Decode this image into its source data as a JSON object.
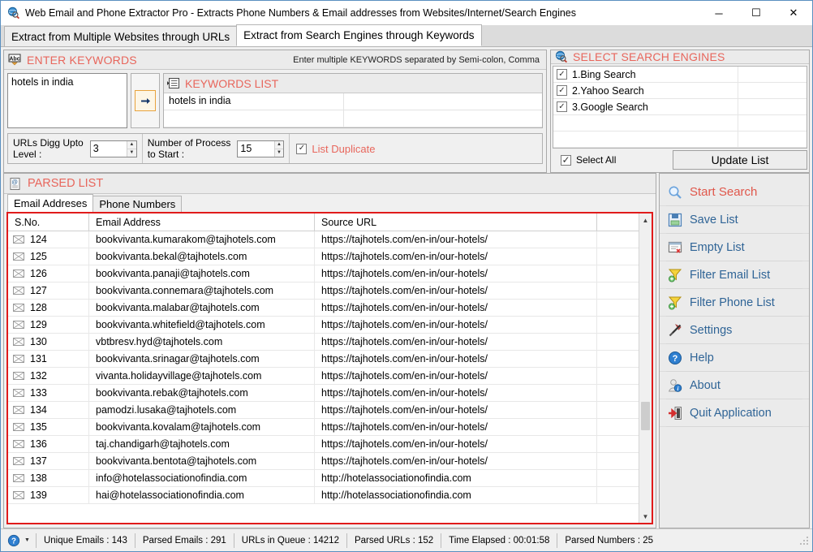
{
  "window": {
    "title": "Web Email and Phone Extractor Pro - Extracts Phone Numbers & Email addresses from Websites/Internet/Search Engines",
    "icon": "globe-search-icon",
    "minimize": "─",
    "maximize": "☐",
    "close": "✕"
  },
  "tabs": [
    {
      "label": "Extract from Multiple Websites through URLs",
      "active": false
    },
    {
      "label": "Extract from Search Engines through Keywords",
      "active": true
    }
  ],
  "keywords_panel": {
    "title": "ENTER KEYWORDS",
    "icon": "abc-spellcheck-icon",
    "hint": "Enter multiple KEYWORDS separated by Semi-colon, Comma",
    "textarea_value": "hotels in india",
    "textarea_placeholder": "",
    "add_button_icon": "arrow-right-icon",
    "list_title": "KEYWORDS LIST",
    "list_icon": "list-icon",
    "list_items": [
      "hotels in india"
    ]
  },
  "options": {
    "digg_level_label": "URLs Digg Upto\nLevel :",
    "digg_level_label_line1": "URLs Digg Upto",
    "digg_level_label_line2": "Level :",
    "digg_level_value": "3",
    "process_label_line1": "Number of Process",
    "process_label_line2": "to Start :",
    "process_value": "15",
    "list_duplicate_label": "List Duplicate",
    "list_duplicate_checked": true
  },
  "search_engines": {
    "title": "SELECT SEARCH ENGINES",
    "icon": "globe-search-icon",
    "items": [
      {
        "label": "1.Bing Search",
        "checked": true
      },
      {
        "label": "2.Yahoo Search",
        "checked": true
      },
      {
        "label": "3.Google Search",
        "checked": true
      }
    ],
    "select_all_label": "Select All",
    "select_all_checked": true,
    "update_button": "Update List"
  },
  "parsed_list": {
    "title": "PARSED LIST",
    "icon": "document-at-icon",
    "tabs": [
      {
        "label": "Email Addreses",
        "active": true
      },
      {
        "label": "Phone Numbers",
        "active": false
      }
    ],
    "columns": [
      "S.No.",
      "Email Address",
      "Source URL",
      ""
    ],
    "rows": [
      {
        "sno": "124",
        "email": "bookvivanta.kumarakom@tajhotels.com",
        "url": "https://tajhotels.com/en-in/our-hotels/"
      },
      {
        "sno": "125",
        "email": "bookvivanta.bekal@tajhotels.com",
        "url": "https://tajhotels.com/en-in/our-hotels/"
      },
      {
        "sno": "126",
        "email": "bookvivanta.panaji@tajhotels.com",
        "url": "https://tajhotels.com/en-in/our-hotels/"
      },
      {
        "sno": "127",
        "email": "bookvivanta.connemara@tajhotels.com",
        "url": "https://tajhotels.com/en-in/our-hotels/"
      },
      {
        "sno": "128",
        "email": "bookvivanta.malabar@tajhotels.com",
        "url": "https://tajhotels.com/en-in/our-hotels/"
      },
      {
        "sno": "129",
        "email": "bookvivanta.whitefield@tajhotels.com",
        "url": "https://tajhotels.com/en-in/our-hotels/"
      },
      {
        "sno": "130",
        "email": "vbtbresv.hyd@tajhotels.com",
        "url": "https://tajhotels.com/en-in/our-hotels/"
      },
      {
        "sno": "131",
        "email": "bookvivanta.srinagar@tajhotels.com",
        "url": "https://tajhotels.com/en-in/our-hotels/"
      },
      {
        "sno": "132",
        "email": "vivanta.holidayvillage@tajhotels.com",
        "url": "https://tajhotels.com/en-in/our-hotels/"
      },
      {
        "sno": "133",
        "email": "bookvivanta.rebak@tajhotels.com",
        "url": "https://tajhotels.com/en-in/our-hotels/"
      },
      {
        "sno": "134",
        "email": "pamodzi.lusaka@tajhotels.com",
        "url": "https://tajhotels.com/en-in/our-hotels/"
      },
      {
        "sno": "135",
        "email": "bookvivanta.kovalam@tajhotels.com",
        "url": "https://tajhotels.com/en-in/our-hotels/"
      },
      {
        "sno": "136",
        "email": "taj.chandigarh@tajhotels.com",
        "url": "https://tajhotels.com/en-in/our-hotels/"
      },
      {
        "sno": "137",
        "email": "bookvivanta.bentota@tajhotels.com",
        "url": "https://tajhotels.com/en-in/our-hotels/"
      },
      {
        "sno": "138",
        "email": "info@hotelassociationofindia.com",
        "url": "http://hotelassociationofindia.com"
      },
      {
        "sno": "139",
        "email": "hai@hotelassociationofindia.com",
        "url": "http://hotelassociationofindia.com"
      }
    ]
  },
  "actions": [
    {
      "label": "Start Search",
      "icon": "magnifier-icon"
    },
    {
      "label": "Save List",
      "icon": "floppy-save-icon"
    },
    {
      "label": "Empty List",
      "icon": "window-delete-icon"
    },
    {
      "label": "Filter Email List",
      "icon": "funnel-plus-icon"
    },
    {
      "label": "Filter Phone List",
      "icon": "funnel-plus-icon"
    },
    {
      "label": "Settings",
      "icon": "hammer-wrench-icon"
    },
    {
      "label": "Help",
      "icon": "question-circle-icon"
    },
    {
      "label": "About",
      "icon": "user-info-icon"
    },
    {
      "label": "Quit Application",
      "icon": "exit-door-icon"
    }
  ],
  "statusbar": {
    "help_icon": "question-circle-icon",
    "cells": [
      "Unique Emails :  143",
      "Parsed Emails :  291",
      "URLs in Queue :  14212",
      "Parsed URLs :  152",
      "Time Elapsed :  00:01:58",
      "Parsed Numbers :  25"
    ]
  },
  "colors": {
    "header_red": "#e8665c",
    "action_blue": "#2f6496",
    "grid_border_red": "#e01b1b",
    "accent_orange": "#e8a33d"
  }
}
